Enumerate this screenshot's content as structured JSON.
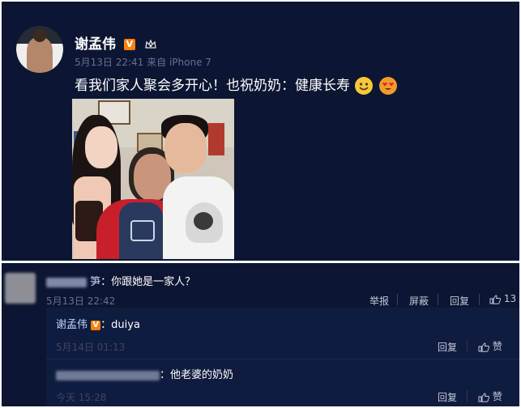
{
  "post": {
    "username": "谢孟伟",
    "verified_badge": "V",
    "timestamp": "5月13日 22:41",
    "source": "来自 iPhone 7",
    "text": "看我们家人聚会多开心！也祝奶奶：健康长寿",
    "emojis": [
      "smile-emoji",
      "heart-eyes-emoji"
    ]
  },
  "comments": [
    {
      "username_suffix": "笋",
      "text": "：你跟她是一家人？",
      "timestamp": "5月13日 22:42",
      "actions": {
        "report": "举报",
        "block": "屏蔽",
        "reply": "回复",
        "like_count": "13"
      }
    }
  ],
  "replies": [
    {
      "username": "谢孟伟",
      "verified_badge": "V",
      "text": "：duiya",
      "timestamp": "5月14日 01:13",
      "actions": {
        "reply": "回复",
        "like": "赞"
      }
    },
    {
      "text": "：他老婆的奶奶",
      "timestamp": "今天 15:28",
      "actions": {
        "reply": "回复",
        "like": "赞"
      }
    }
  ],
  "colors": {
    "background": "#0c1633",
    "nested_background": "#101c3f",
    "link": "#c7d3ff",
    "badge": "#ff8200",
    "meta_text": "#68708c"
  }
}
